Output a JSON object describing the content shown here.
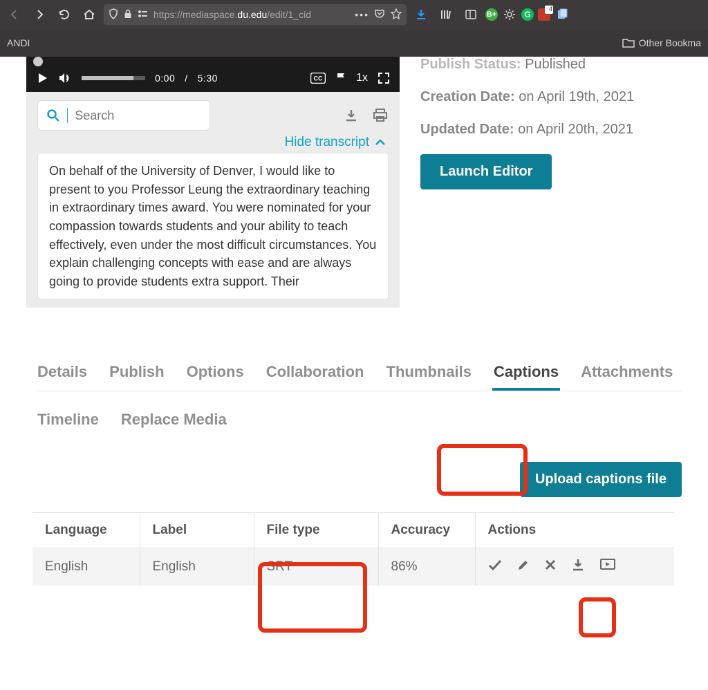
{
  "chrome": {
    "url_prefix": "https://mediaspace.",
    "url_bold": "du.edu",
    "url_suffix": "/edit/1_cid",
    "badge4": "4"
  },
  "bookmarks": {
    "left": "ANDI",
    "right": "Other Bookma"
  },
  "player": {
    "current": "0:00",
    "sep": "/",
    "total": "5:30",
    "speed": "1x"
  },
  "searchPlaceholder": "Search",
  "hideTranscript": "Hide transcript",
  "transcript": "On behalf of the University of Denver, I would like to present to you Professor Leung the extraordinary teaching in extraordinary times award. You were nominated for your compassion towards students and your ability to teach effectively, even under the most difficult circumstances. You explain challenging concepts with ease and are always going to provide students extra support. Their",
  "meta": {
    "publishStatusLabel": "Publish Status:",
    "publishStatusValue": "Published",
    "creationLabel": "Creation Date:",
    "creationValue": "on April 19th, 2021",
    "updatedLabel": "Updated Date:",
    "updatedValue": "on April 20th, 2021",
    "launch": "Launch Editor"
  },
  "tabs": {
    "details": "Details",
    "publish": "Publish",
    "options": "Options",
    "collab": "Collaboration",
    "thumbs": "Thumbnails",
    "captions": "Captions",
    "attach": "Attachments",
    "timeline": "Timeline",
    "replace": "Replace Media"
  },
  "uploadBtn": "Upload captions file",
  "capTable": {
    "h_lang": "Language",
    "h_label": "Label",
    "h_type": "File type",
    "h_acc": "Accuracy",
    "h_actions": "Actions",
    "row": {
      "lang": "English",
      "label": "English",
      "type": "SRT",
      "acc": "86%"
    }
  }
}
